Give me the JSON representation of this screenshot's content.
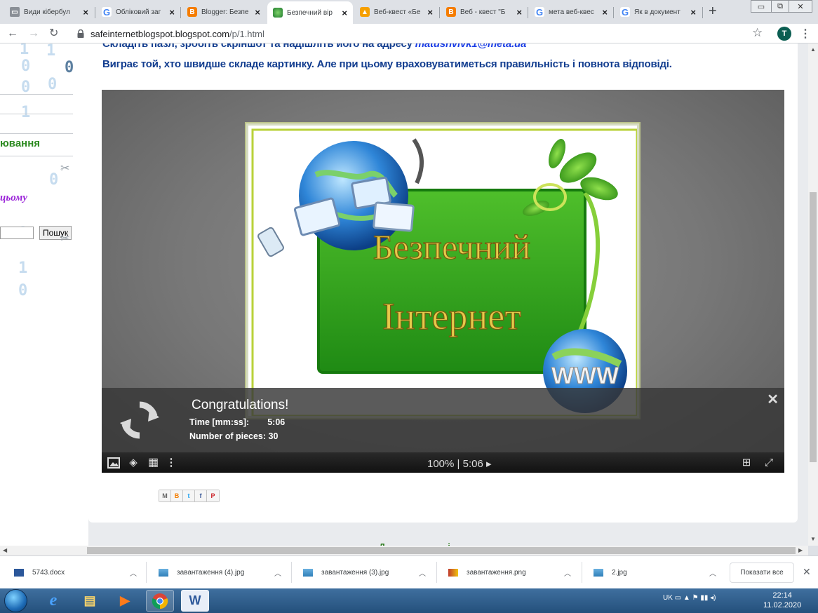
{
  "browser": {
    "tabs": [
      {
        "title": "Види кібербул",
        "favicon": "laptop-icon",
        "active": false
      },
      {
        "title": "Обліковий заг",
        "favicon": "google-icon",
        "active": false
      },
      {
        "title": "Blogger: Безпе",
        "favicon": "blogger-icon",
        "active": false
      },
      {
        "title": "Безпечний вір",
        "favicon": "globe-icon",
        "active": true
      },
      {
        "title": "Веб-квест «Бе",
        "favicon": "vlc-icon",
        "active": false
      },
      {
        "title": "Веб - квест \"Б",
        "favicon": "blogger-icon",
        "active": false
      },
      {
        "title": "мета веб-квес",
        "favicon": "google-icon",
        "active": false
      },
      {
        "title": "Як в документ",
        "favicon": "google-icon",
        "active": false
      }
    ],
    "url_host": "safeinternetblogspot.blogspot.com",
    "url_path": "/p/1.html",
    "profile_initial": "T"
  },
  "sidebar": {
    "text_1": "ювання",
    "text_2": "цьому",
    "search_button": "Пошук",
    "matrix_digits": [
      "1",
      "0",
      "0",
      "1",
      "0",
      "0",
      "1",
      "0",
      "1",
      "1",
      "0"
    ]
  },
  "article": {
    "line1_text": "Складіть пазл, зробіть скріншот та надішліть його на адресу ",
    "line1_email": "matushvivk1@meta.ua",
    "line2": "Виграє той, хто швидше складе картинку. Але при цьому враховуватиметься правильність і повнота відповіді."
  },
  "puzzle": {
    "image_title_1": "Безпечний",
    "image_title_2": "Інтернет",
    "image_www": "WWW",
    "congrats": "Congratulations!",
    "time_label": "Time [mm:ss]:",
    "time_value": "5:06",
    "pieces_label": "Number of pieces: 30",
    "status": "100% | 5:06 ▸",
    "close": "✕"
  },
  "share": [
    "M",
    "B",
    "t",
    "f",
    "P"
  ],
  "below_text": "Д . . . . . . і",
  "downloads": {
    "items": [
      {
        "name": "5743.docx",
        "icon": "word-doc-icon"
      },
      {
        "name": "завантаження (4).jpg",
        "icon": "image-file-icon"
      },
      {
        "name": "завантаження (3).jpg",
        "icon": "image-file-icon"
      },
      {
        "name": "завантаження.png",
        "icon": "png-file-icon"
      },
      {
        "name": "2.jpg",
        "icon": "image-file-icon"
      }
    ],
    "show_all": "Показати все"
  },
  "taskbar": {
    "language": "UK",
    "time": "22:14",
    "date": "11.02.2020"
  }
}
